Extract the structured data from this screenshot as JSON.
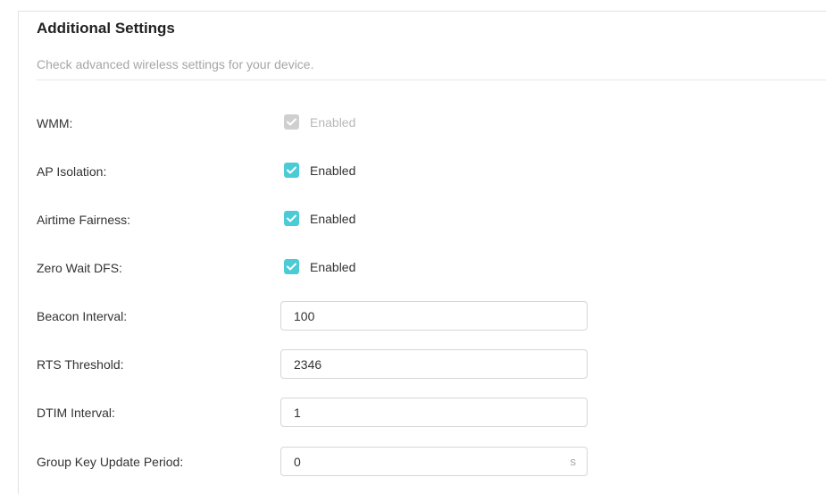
{
  "section": {
    "title": "Additional Settings",
    "subtitle": "Check advanced wireless settings for your device."
  },
  "toggles": [
    {
      "label": "WMM:",
      "option_label": "Enabled",
      "checked": true,
      "disabled": true
    },
    {
      "label": "AP Isolation:",
      "option_label": "Enabled",
      "checked": true,
      "disabled": false
    },
    {
      "label": "Airtime Fairness:",
      "option_label": "Enabled",
      "checked": true,
      "disabled": false
    },
    {
      "label": "Zero Wait DFS:",
      "option_label": "Enabled",
      "checked": true,
      "disabled": false
    }
  ],
  "fields": [
    {
      "label": "Beacon Interval:",
      "value": "100",
      "unit": ""
    },
    {
      "label": "RTS Threshold:",
      "value": "2346",
      "unit": ""
    },
    {
      "label": "DTIM Interval:",
      "value": "1",
      "unit": ""
    },
    {
      "label": "Group Key Update Period:",
      "value": "0",
      "unit": "s"
    }
  ],
  "colors": {
    "accent": "#4acbd6",
    "disabled": "#cfcfcf"
  }
}
